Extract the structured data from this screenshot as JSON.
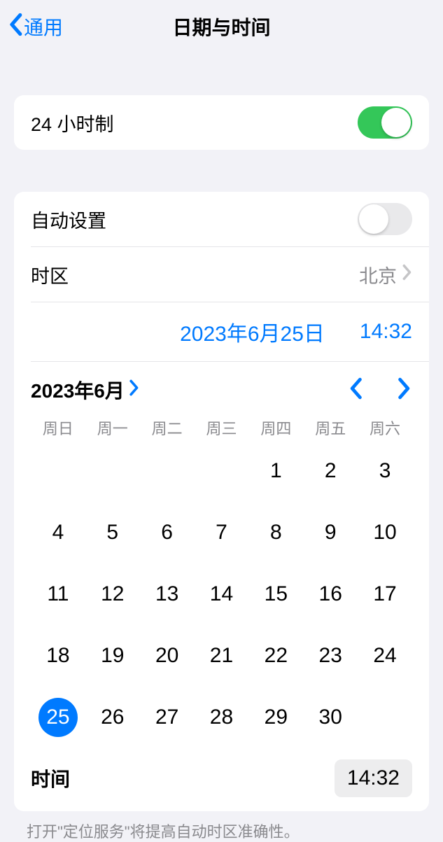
{
  "nav": {
    "back_label": "通用",
    "title": "日期与时间"
  },
  "settings": {
    "twenty_four_hour_label": "24 小时制",
    "twenty_four_hour_on": true,
    "auto_set_label": "自动设置",
    "auto_set_on": false,
    "timezone_label": "时区",
    "timezone_value": "北京"
  },
  "datetime": {
    "date_display": "2023年6月25日",
    "time_display": "14:32"
  },
  "calendar": {
    "month_label": "2023年6月",
    "weekdays": [
      "周日",
      "周一",
      "周二",
      "周三",
      "周四",
      "周五",
      "周六"
    ],
    "leading_blanks": 4,
    "days": [
      1,
      2,
      3,
      4,
      5,
      6,
      7,
      8,
      9,
      10,
      11,
      12,
      13,
      14,
      15,
      16,
      17,
      18,
      19,
      20,
      21,
      22,
      23,
      24,
      25,
      26,
      27,
      28,
      29,
      30
    ],
    "selected_day": 25,
    "time_label": "时间",
    "time_value": "14:32"
  },
  "footer": {
    "note": "打开\"定位服务\"将提高自动时区准确性。"
  }
}
